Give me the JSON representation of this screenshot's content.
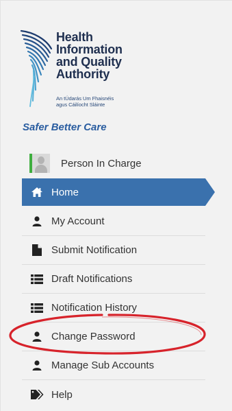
{
  "logo": {
    "lines": [
      "Health",
      "Information",
      "and Quality",
      "Authority"
    ],
    "irish_lines": [
      "An tÚdarás Um Fhaisnéis",
      "agus Cáilíocht Sláinte"
    ],
    "tagline": "Safer Better Care"
  },
  "user": {
    "name": "Person In Charge"
  },
  "nav": {
    "items": [
      {
        "label": "Home",
        "icon": "home-icon",
        "active": true
      },
      {
        "label": "My Account",
        "icon": "user-icon"
      },
      {
        "label": "Submit Notification",
        "icon": "file-icon"
      },
      {
        "label": "Draft Notifications",
        "icon": "list-icon"
      },
      {
        "label": "Notification History",
        "icon": "list-icon"
      },
      {
        "label": "Change Password",
        "icon": "user-icon"
      },
      {
        "label": "Manage Sub Accounts",
        "icon": "user-icon"
      },
      {
        "label": "Help",
        "icon": "tag-icon"
      }
    ]
  },
  "colors": {
    "active_bg": "#3a71ad",
    "highlight_ring": "#d7232b",
    "brand_navy": "#1f2f4f",
    "tagline_blue": "#2a5da0"
  }
}
